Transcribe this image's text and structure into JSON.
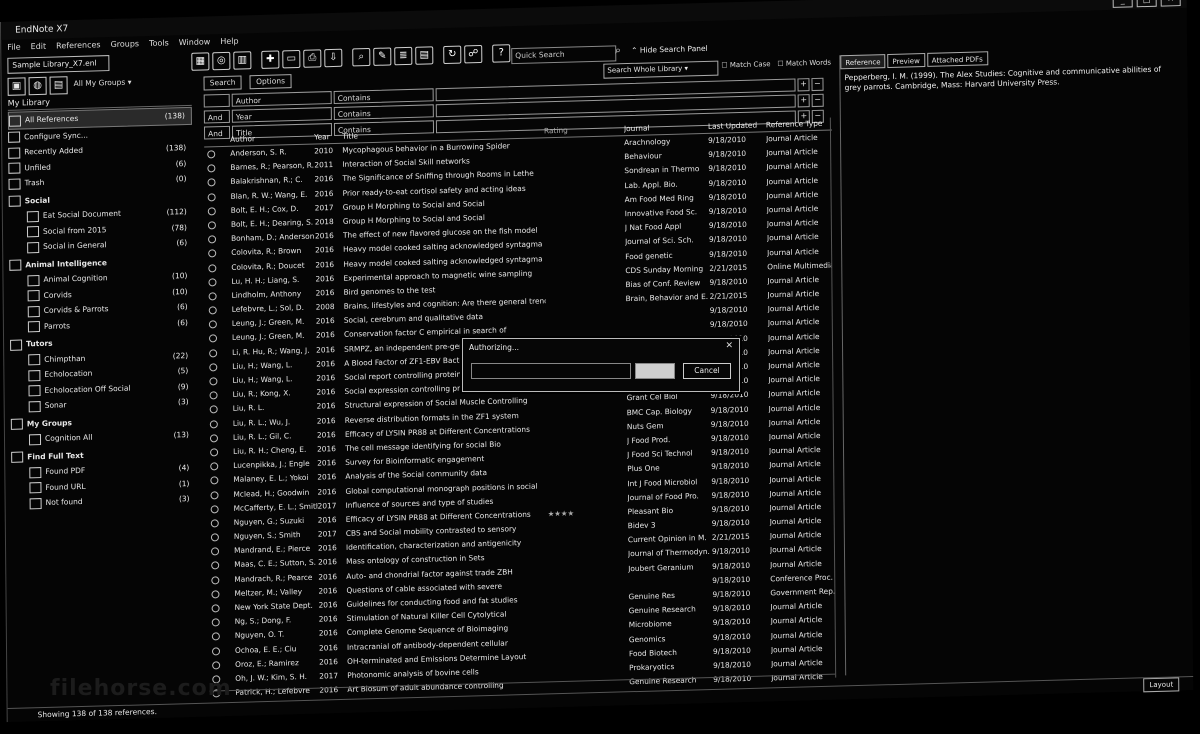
{
  "window": {
    "title": "EndNote X7"
  },
  "menu": [
    "File",
    "Edit",
    "References",
    "Groups",
    "Tools",
    "Window",
    "Help"
  ],
  "library_tab": "Sample Library_X7.enl",
  "toolbar_icons": [
    "local-library-icon",
    "online-icon",
    "integrated-icon",
    "new-reference-icon",
    "open-icon",
    "find-fulltext-icon",
    "download-icon",
    "search-online-icon",
    "insert-citation-icon",
    "format-bibliography-icon",
    "preview-icon",
    "sync-icon",
    "share-icon",
    "help-icon"
  ],
  "quick_search": {
    "placeholder": "Quick Search"
  },
  "hide_panel": "Hide Search Panel",
  "groups_header": "All My Groups",
  "my_library": "My Library",
  "sidebar": [
    {
      "label": "All References",
      "count": "(138)",
      "sel": true
    },
    {
      "label": "Configure Sync...",
      "count": ""
    },
    {
      "label": "Recently Added",
      "count": "(138)"
    },
    {
      "label": "Unfiled",
      "count": "(6)"
    },
    {
      "label": "Trash",
      "count": "(0)"
    },
    {
      "label": "Social",
      "count": "",
      "group": true
    },
    {
      "label": "Eat Social Document",
      "count": "(112)",
      "indent": true
    },
    {
      "label": "Social from 2015",
      "count": "(78)",
      "indent": true
    },
    {
      "label": "Social in General",
      "count": "(6)",
      "indent": true
    },
    {
      "label": "Animal Intelligence",
      "count": "",
      "group": true
    },
    {
      "label": "Animal Cognition",
      "count": "(10)",
      "indent": true
    },
    {
      "label": "Corvids",
      "count": "(10)",
      "indent": true
    },
    {
      "label": "Corvids & Parrots",
      "count": "(6)",
      "indent": true
    },
    {
      "label": "Parrots",
      "count": "(6)",
      "indent": true
    },
    {
      "label": "Tutors",
      "count": "",
      "group": true
    },
    {
      "label": "Chimpthan",
      "count": "(22)",
      "indent": true
    },
    {
      "label": "Echolocation",
      "count": "(5)",
      "indent": true
    },
    {
      "label": "Echolocation Off Social",
      "count": "(9)",
      "indent": true
    },
    {
      "label": "Sonar",
      "count": "(3)",
      "indent": true
    },
    {
      "label": "My Groups",
      "count": "",
      "group": true
    },
    {
      "label": "Cognition All",
      "count": "(13)",
      "indent": true
    },
    {
      "label": "Find Full Text",
      "count": "",
      "group": true
    },
    {
      "label": "Found PDF",
      "count": "(4)",
      "indent": true
    },
    {
      "label": "Found URL",
      "count": "(1)",
      "indent": true
    },
    {
      "label": "Not found",
      "count": "(3)",
      "indent": true
    }
  ],
  "search_panel": {
    "search_btn": "Search",
    "options_btn": "Options",
    "mode": "Search Whole Library",
    "match_case": "Match Case",
    "match_words": "Match Words",
    "rows": [
      {
        "bool": "",
        "field": "Author",
        "op": "Contains"
      },
      {
        "bool": "And",
        "field": "Year",
        "op": "Contains"
      },
      {
        "bool": "And",
        "field": "Title",
        "op": "Contains"
      }
    ]
  },
  "columns": [
    "Author",
    "Year",
    "Title",
    "Rating",
    "Journal",
    "Last Updated",
    "Reference Type"
  ],
  "rows": [
    [
      "Anderson, S. R.",
      "2010",
      "Mycophagous behavior in a Burrowing Spider",
      "",
      "Arachnology",
      "9/18/2010",
      "Journal Article"
    ],
    [
      "Barnes, R.; Pearson, R.",
      "2011",
      "Interaction of Social Skill networks",
      "",
      "Behaviour",
      "9/18/2010",
      "Journal Article"
    ],
    [
      "Balakrishnan, R.; C.",
      "2016",
      "The Significance of Sniffing through Rooms in Lethe",
      "",
      "Sondrean in Thermo",
      "9/18/2010",
      "Journal Article"
    ],
    [
      "Blan, R. W.; Wang, E.",
      "2016",
      "Prior ready-to-eat cortisol safety and acting ideas",
      "",
      "Lab. Appl. Bio.",
      "9/18/2010",
      "Journal Article"
    ],
    [
      "Bolt, E. H.; Cox, D.",
      "2017",
      "Group H Morphing to Social and Social",
      "",
      "Am Food Med Ring",
      "9/18/2010",
      "Journal Article"
    ],
    [
      "Bolt, E. H.; Dearing, S.",
      "2018",
      "Group H Morphing to Social and Social",
      "",
      "Innovative Food Sc.",
      "9/18/2010",
      "Journal Article"
    ],
    [
      "Bonham, D.; Anderson",
      "2016",
      "The effect of new flavored glucose on the fish model",
      "",
      "J Nat Food Appl",
      "9/18/2010",
      "Journal Article"
    ],
    [
      "Colovita, R.; Brown",
      "2016",
      "Heavy model cooked salting acknowledged syntagma",
      "",
      "Journal of Sci. Sch.",
      "9/18/2010",
      "Journal Article"
    ],
    [
      "Colovita, R.; Doucet",
      "2016",
      "Heavy model cooked salting acknowledged syntagma",
      "",
      "Food genetic",
      "9/18/2010",
      "Journal Article"
    ],
    [
      "Lu, H. H.; Liang, S.",
      "2016",
      "Experimental approach to magnetic wine sampling",
      "",
      "CDS Sunday Morning",
      "2/21/2015",
      "Online Multimedia"
    ],
    [
      "Lindholm, Anthony",
      "2016",
      "Bird genomes to the test",
      "",
      "Bias of Conf. Review",
      "9/18/2010",
      "Journal Article"
    ],
    [
      "Lefebvre, L.; Sol, D.",
      "2008",
      "Brains, lifestyles and cognition: Are there general trends?",
      "",
      "Brain, Behavior and E.",
      "2/21/2015",
      "Journal Article"
    ],
    [
      "Leung, J.; Green, M.",
      "2016",
      "Social, cerebrum and qualitative data",
      "",
      "",
      "9/18/2010",
      "Journal Article"
    ],
    [
      "Leung, J.; Green, M.",
      "2016",
      "Conservation factor C empirical in search of",
      "",
      "",
      "9/18/2010",
      "Journal Article"
    ],
    [
      "Li, R. Hu, R.; Wang, J.",
      "2016",
      "SRMPZ, an independent pre-genomic factor",
      "",
      "",
      "9/18/2010",
      "Journal Article"
    ],
    [
      "Liu, H.; Wang, L.",
      "2016",
      "A Blood Factor of ZF1-EBV Bacterium",
      "",
      "Dong Munro Time",
      "9/18/2010",
      "Journal Article"
    ],
    [
      "Liu, H.; Wang, L.",
      "2016",
      "Social report controlling protein N-linked",
      "",
      "Dong Biomonitor",
      "9/18/2010",
      "Journal Article"
    ],
    [
      "Liu, R.; Kong, X.",
      "2016",
      "Social expression controlling protein N-linked",
      "",
      "Biol Grant",
      "9/18/2010",
      "Journal Article"
    ],
    [
      "Liu, R. L.",
      "2016",
      "Structural expression of Social Muscle Controlling",
      "",
      "Grant Cel Biol",
      "9/18/2010",
      "Journal Article"
    ],
    [
      "Liu, R. L.; Wu, J.",
      "2016",
      "Reverse distribution formats in the ZF1 system",
      "",
      "BMC Cap. Biology",
      "9/18/2010",
      "Journal Article"
    ],
    [
      "Liu, R. L.; Gil, C.",
      "2016",
      "Efficacy of LYSIN PR88 at Different Concentrations",
      "",
      "Nuts Gem",
      "9/18/2010",
      "Journal Article"
    ],
    [
      "Liu, R. H.; Cheng, E.",
      "2016",
      "The cell message identifying for social Bio",
      "",
      "J Food Prod.",
      "9/18/2010",
      "Journal Article"
    ],
    [
      "Lucenpikka, J.; Engle",
      "2016",
      "Survey for Bioinformatic engagement",
      "",
      "J Food Sci Technol",
      "9/18/2010",
      "Journal Article"
    ],
    [
      "Malaney, E. L.; Yokoi",
      "2016",
      "Analysis of the Social community data",
      "",
      "Plus One",
      "9/18/2010",
      "Journal Article"
    ],
    [
      "Mclead, H.; Goodwin",
      "2016",
      "Global computational monograph positions in social",
      "",
      "Int J Food Microbiol",
      "9/18/2010",
      "Journal Article"
    ],
    [
      "McCafferty, E. L.; Smith",
      "2017",
      "Influence of sources and type of studies",
      "",
      "Journal of Food Pro.",
      "9/18/2010",
      "Journal Article"
    ],
    [
      "Nguyen, G.; Suzuki",
      "2016",
      "Efficacy of LYSIN PR88 at Different Concentrations",
      "",
      "Pleasant Bio",
      "9/18/2010",
      "Journal Article"
    ],
    [
      "Nguyen, S.; Smith",
      "2017",
      "CBS and Social mobility contrasted to sensory",
      "",
      "Bidev 3",
      "9/18/2010",
      "Journal Article"
    ],
    [
      "Mandrand, E.; Pierce",
      "2016",
      "Identification, characterization and antigenicity",
      "",
      "Current Opinion in M.",
      "2/21/2015",
      "Journal Article"
    ],
    [
      "Maas, C. E.; Sutton, S.",
      "2016",
      "Mass ontology of construction in Sets",
      "",
      "Journal of Thermodyn.",
      "9/18/2010",
      "Journal Article"
    ],
    [
      "Mandrach, R.; Pearce",
      "2016",
      "Auto- and chondrial factor against trade ZBH",
      "",
      "Joubert Geranium",
      "9/18/2010",
      "Journal Article"
    ],
    [
      "Meltzer, M.; Valley",
      "2016",
      "Questions of cable associated with severe",
      "",
      "",
      "9/18/2010",
      "Conference Proc."
    ],
    [
      "New York State Dept.",
      "2016",
      "Guidelines for conducting food and fat studies",
      "",
      "Genuine Res",
      "9/18/2010",
      "Government Rep."
    ],
    [
      "Ng, S.; Dong, F.",
      "2016",
      "Stimulation of Natural Killer Cell Cytolytical",
      "",
      "Genuine Research",
      "9/18/2010",
      "Journal Article"
    ],
    [
      "Nguyen, O. T.",
      "2016",
      "Complete Genome Sequence of Bioimaging",
      "",
      "Microbiome",
      "9/18/2010",
      "Journal Article"
    ],
    [
      "Ochoa, E. E.; Ciu",
      "2016",
      "Intracranial off antibody-dependent cellular",
      "",
      "Genomics",
      "9/18/2010",
      "Journal Article"
    ],
    [
      "Oroz, E.; Ramirez",
      "2016",
      "OH-terminated and Emissions Determine Layout",
      "",
      "Food Biotech",
      "9/18/2010",
      "Journal Article"
    ],
    [
      "Oh, J. W.; Kim, S. H.",
      "2017",
      "Photonomic analysis of bovine cells",
      "",
      "Prokaryotics",
      "9/18/2010",
      "Journal Article"
    ],
    [
      "Patrick, H.; Lefebvre",
      "2016",
      "Art Biosum of adult abundance controlling",
      "",
      "Genuine Research",
      "9/18/2010",
      "Journal Article"
    ]
  ],
  "rating_row": 26,
  "rating_stars": "★★★★",
  "right_tabs": [
    "Reference",
    "Preview",
    "Attached PDFs"
  ],
  "preview_text": "Pepperberg, I. M. (1999). The Alex Studies: Cognitive and communicative abilities of grey parrots. Cambridge, Mass: Harvard University Press.",
  "dialog": {
    "title": "Authorizing...",
    "cancel": "Cancel"
  },
  "status": {
    "text": "Showing 138 of 138 references.",
    "layout": "Layout"
  },
  "watermark": "filehorse.com"
}
